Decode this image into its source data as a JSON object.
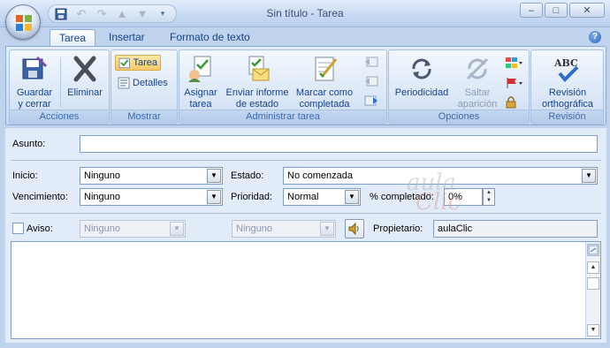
{
  "window": {
    "title": "Sin título - Tarea",
    "minimize": "–",
    "maximize": "□",
    "close": "✕"
  },
  "qat": {
    "icons": [
      "save-icon",
      "undo-icon",
      "redo-icon",
      "up-arrow-icon",
      "down-arrow-icon",
      "customize-qat-icon"
    ]
  },
  "tabs": [
    {
      "label": "Tarea",
      "active": true
    },
    {
      "label": "Insertar",
      "active": false
    },
    {
      "label": "Formato de texto",
      "active": false
    }
  ],
  "ribbon": {
    "acciones": {
      "label": "Acciones",
      "guardar": "Guardar\ny cerrar",
      "eliminar": "Eliminar"
    },
    "mostrar": {
      "label": "Mostrar",
      "tarea": "Tarea",
      "detalles": "Detalles"
    },
    "administrar": {
      "label": "Administrar tarea",
      "asignar": "Asignar\ntarea",
      "enviar": "Enviar informe\nde estado",
      "marcar": "Marcar como\ncompletada"
    },
    "opciones": {
      "label": "Opciones",
      "periodicidad": "Periodicidad",
      "saltar": "Saltar\naparición"
    },
    "revision": {
      "label": "Revisión",
      "revision_btn": "Revisión\northográfica"
    }
  },
  "form": {
    "asunto_label": "Asunto:",
    "asunto_value": "",
    "inicio_label": "Inicio:",
    "inicio_value": "Ninguno",
    "vencimiento_label": "Vencimiento:",
    "vencimiento_value": "Ninguno",
    "estado_label": "Estado:",
    "estado_value": "No comenzada",
    "prioridad_label": "Prioridad:",
    "prioridad_value": "Normal",
    "completado_label": "% completado:",
    "completado_value": "0%",
    "aviso_label": "Aviso:",
    "aviso_date": "Ninguno",
    "aviso_time": "Ninguno",
    "propietario_label": "Propietario:",
    "propietario_value": "aulaClic"
  },
  "watermark": {
    "aula": "aula",
    "clic": "Clic"
  }
}
